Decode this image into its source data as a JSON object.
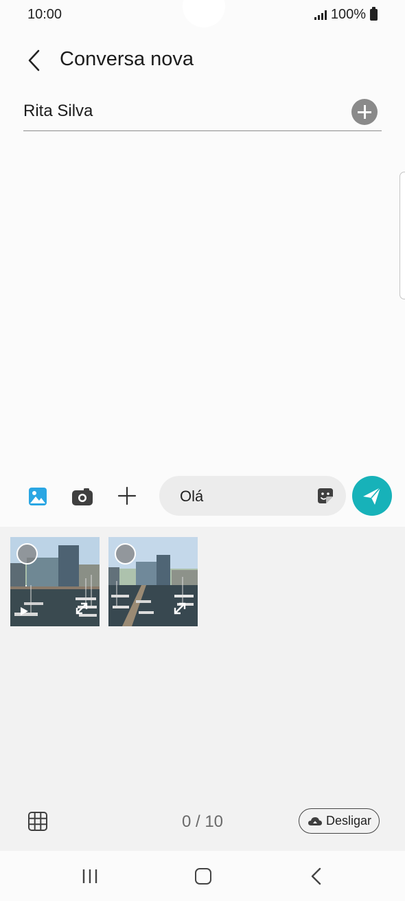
{
  "status_bar": {
    "time": "10:00",
    "battery": "100%"
  },
  "header": {
    "title": "Conversa nova"
  },
  "recipient": {
    "name": "Rita Silva"
  },
  "composer": {
    "message": "Olá"
  },
  "media": {
    "thumbnails": [
      {
        "type": "video"
      },
      {
        "type": "photo"
      }
    ],
    "counter": "0 / 10",
    "disconnect_label": "Desligar"
  },
  "colors": {
    "accent": "#17b2b9",
    "gallery_icon": "#2aa6e3",
    "panel_bg": "#f2f2f2"
  }
}
